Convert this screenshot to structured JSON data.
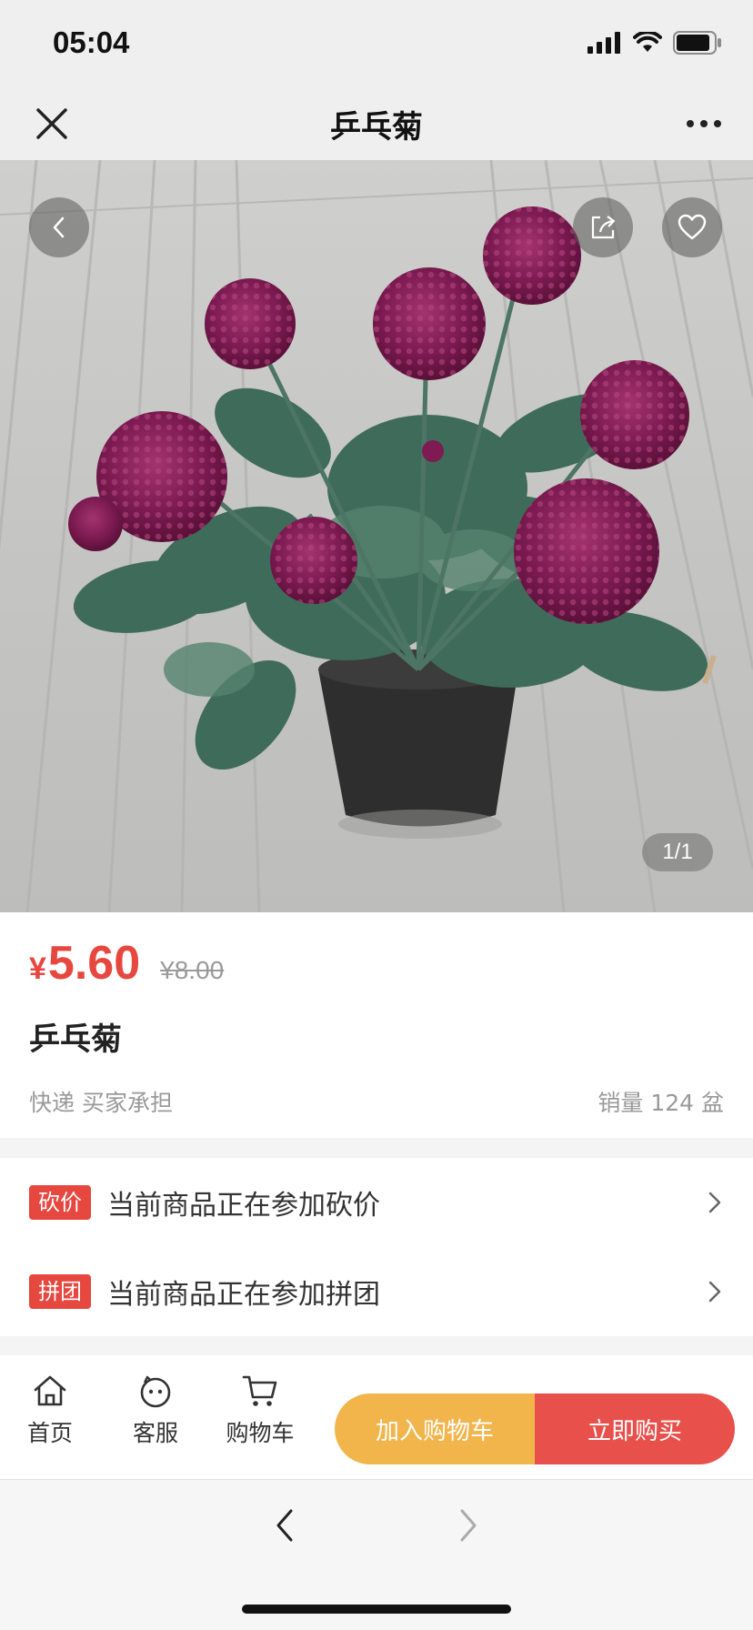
{
  "status_bar": {
    "time": "05:04"
  },
  "nav": {
    "title": "乒乓菊"
  },
  "hero": {
    "pager": "1/1"
  },
  "product": {
    "currency": "¥",
    "price": "5.60",
    "original_price": "¥8.00",
    "title": "乒乓菊",
    "shipping": "快递 买家承担",
    "sales": "销量 124 盆"
  },
  "promotions": [
    {
      "tag": "砍价",
      "text": "当前商品正在参加砍价"
    },
    {
      "tag": "拼团",
      "text": "当前商品正在参加拼团"
    }
  ],
  "tabs": {
    "home": "首页",
    "service": "客服",
    "cart": "购物车"
  },
  "actions": {
    "add_to_cart": "加入购物车",
    "buy_now": "立即购买"
  },
  "colors": {
    "accent_red": "#e6473f",
    "cart_button": "#f1b54c",
    "buy_button": "#e8504b"
  }
}
